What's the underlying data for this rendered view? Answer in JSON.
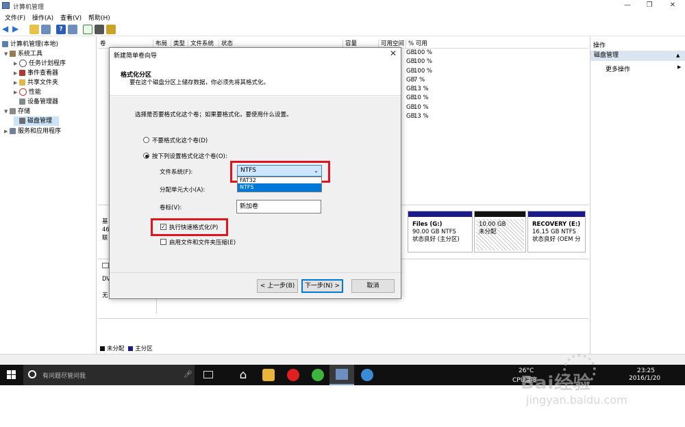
{
  "window": {
    "title": "计算机管理",
    "buttons": [
      "—",
      "❐",
      "✕"
    ]
  },
  "menu": [
    "文件(F)",
    "操作(A)",
    "查看(V)",
    "帮助(H)"
  ],
  "tree": {
    "items": [
      {
        "label": "计算机管理(本地)",
        "indent": 0,
        "arrow": ""
      },
      {
        "label": "系统工具",
        "indent": 1,
        "arrow": "▼"
      },
      {
        "label": "任务计划程序",
        "indent": 2,
        "arrow": "▶"
      },
      {
        "label": "事件查看器",
        "indent": 2,
        "arrow": "▶"
      },
      {
        "label": "共享文件夹",
        "indent": 2,
        "arrow": "▶"
      },
      {
        "label": "性能",
        "indent": 2,
        "arrow": "▶"
      },
      {
        "label": "设备管理器",
        "indent": 2,
        "arrow": ""
      },
      {
        "label": "存储",
        "indent": 1,
        "arrow": "▼"
      },
      {
        "label": "磁盘管理",
        "indent": 2,
        "arrow": ""
      },
      {
        "label": "服务和应用程序",
        "indent": 1,
        "arrow": "▶"
      }
    ]
  },
  "volume_list": {
    "columns": [
      "卷",
      "布局",
      "类型",
      "文件系统",
      "状态",
      "容量",
      "可用空间",
      "% 可用"
    ],
    "rows": [
      {
        "gb": "GB",
        "pct": "100 %"
      },
      {
        "gb": "GB",
        "pct": "100 %"
      },
      {
        "gb": "GB",
        "pct": "100 %"
      },
      {
        "gb": "GB",
        "pct": "7 %"
      },
      {
        "gb": "GB",
        "pct": "13 %"
      },
      {
        "gb": "GB",
        "pct": "10 %"
      },
      {
        "gb": "GB",
        "pct": "10 %"
      },
      {
        "gb": "GB",
        "pct": "13 %"
      }
    ]
  },
  "disk_area": {
    "disk0_left": [
      "基",
      "46",
      "联"
    ],
    "cdrom_left": [
      "DV",
      "无"
    ],
    "partitions": [
      {
        "name": "Files  (G:)",
        "size": "90.00 GB NTFS",
        "status": "状态良好 (主分区)"
      },
      {
        "name": "",
        "size": "10.00 GB",
        "status": "未分配"
      },
      {
        "name": "RECOVERY  (E:)",
        "size": "16.15 GB NTFS",
        "status": "状态良好 (OEM 分"
      }
    ],
    "legend": [
      "未分配",
      "主分区"
    ]
  },
  "actions": {
    "header": "操作",
    "section": "磁盘管理",
    "more": "更多操作"
  },
  "dialog": {
    "title": "新建简单卷向导",
    "heading": "格式化分区",
    "subheading": "要在这个磁盘分区上储存数据，你必须先将其格式化。",
    "prompt": "选择是否要格式化这个卷；如果要格式化，要使用什么设置。",
    "opt_no_format": "不要格式化这个卷(D)",
    "opt_format": "按下列设置格式化这个卷(O):",
    "fs_label": "文件系统(F):",
    "fs_value": "NTFS",
    "fs_options": [
      "FAT32",
      "NTFS"
    ],
    "alloc_label": "分配单元大小(A):",
    "vol_label": "卷标(V):",
    "vol_value": "新加卷",
    "quick_format": "执行快速格式化(P)",
    "compress": "启用文件和文件夹压缩(E)",
    "back": "< 上一步(B)",
    "next": "下一步(N) >",
    "cancel": "取消"
  },
  "taskbar": {
    "search": "有问题尽管问我",
    "temp": "26°C",
    "cpu": "CPU温度",
    "time": "23:25",
    "date": "2016/1/20"
  },
  "watermark": {
    "brand": "Bai经验",
    "url": "jingyan.baidu.com"
  },
  "colors": {
    "accent": "#1a1a8c",
    "highlight": "#e0141e",
    "selection": "#0078d7"
  }
}
